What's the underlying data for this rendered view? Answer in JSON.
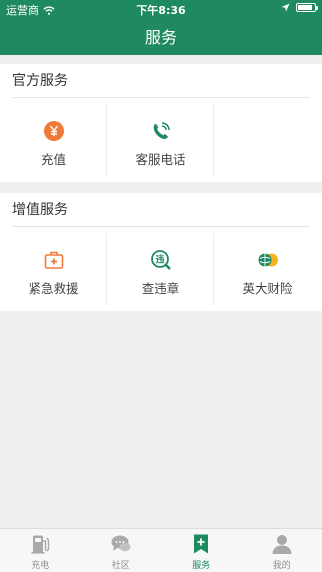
{
  "status": {
    "carrier": "运营商",
    "time": "下午8:36"
  },
  "header": {
    "title": "服务"
  },
  "sections": [
    {
      "title": "官方服务",
      "items": [
        {
          "label": "充值",
          "icon": "yen-coin-icon"
        },
        {
          "label": "客服电话",
          "icon": "phone-icon"
        }
      ]
    },
    {
      "title": "增值服务",
      "items": [
        {
          "label": "紧急救援",
          "icon": "first-aid-kit-icon"
        },
        {
          "label": "查违章",
          "icon": "violation-search-icon"
        },
        {
          "label": "英大财险",
          "icon": "yingda-insurance-logo-icon"
        }
      ]
    }
  ],
  "tabs": [
    {
      "label": "充电",
      "icon": "charging-station-icon",
      "active": false
    },
    {
      "label": "社区",
      "icon": "chat-bubbles-icon",
      "active": false
    },
    {
      "label": "服务",
      "icon": "bookmark-plus-icon",
      "active": true
    },
    {
      "label": "我的",
      "icon": "person-icon",
      "active": false
    }
  ],
  "colors": {
    "brand": "#1f8a5f",
    "accent_orange": "#f07a3a",
    "tab_inactive": "#8e8e8e"
  }
}
